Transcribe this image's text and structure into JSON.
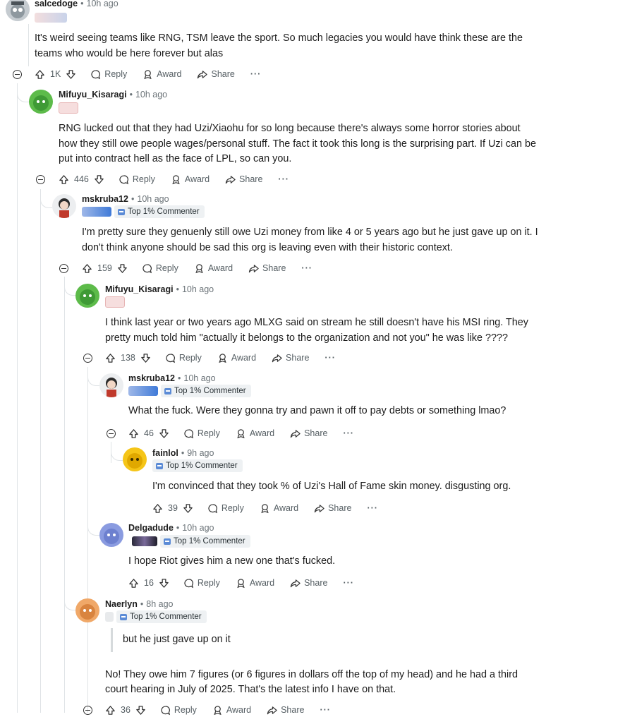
{
  "labels": {
    "reply": "Reply",
    "award": "Award",
    "share": "Share",
    "more": "···"
  },
  "comments": [
    {
      "user": "salcedoge",
      "time": "10h ago",
      "votes": "1K",
      "text": "It's weird seeing teams like RNG, TSM leave the sport. So much legacies you would have think these are the teams who would be here forever but alas"
    },
    {
      "user": "Mifuyu_Kisaragi",
      "time": "10h ago",
      "votes": "446",
      "text": "RNG lucked out that they had Uzi/Xiaohu for so long because there's always some horror stories about how they still owe people wages/personal stuff. The fact it took this long is the surprising part. If Uzi can be put into contract hell as the face of LPL, so can you."
    },
    {
      "user": "mskruba12",
      "time": "10h ago",
      "votes": "159",
      "badge": "Top 1% Commenter",
      "text": "I'm pretty sure they genuenly still owe Uzi money from like 4 or 5 years ago but he just gave up on it. I don't think anyone should be sad this org is leaving even with their historic context."
    },
    {
      "user": "Mifuyu_Kisaragi",
      "time": "10h ago",
      "votes": "138",
      "text": "I think last year or two years ago MLXG said on stream he still doesn't have his MSI ring. They pretty much told him \"actually it belongs to the organization and not you\" he was like ????"
    },
    {
      "user": "mskruba12",
      "time": "10h ago",
      "votes": "46",
      "badge": "Top 1% Commenter",
      "text": "What the fuck. Were they gonna try and pawn it off to pay debts or something lmao?"
    },
    {
      "user": "fainlol",
      "time": "9h ago",
      "votes": "39",
      "badge": "Top 1% Commenter",
      "text": "I'm convinced that they took % of Uzi's Hall of Fame skin money. disgusting org."
    },
    {
      "user": "Delgadude",
      "time": "10h ago",
      "votes": "16",
      "badge": "Top 1% Commenter",
      "text": "I hope Riot gives him a new one that's fucked."
    },
    {
      "user": "Naerlyn",
      "time": "8h ago",
      "votes": "36",
      "badge": "Top 1% Commenter",
      "quote": "but he just gave up on it",
      "text": "No! They owe him 7 figures (or 6 figures in dollars off the top of my head) and he had a third court hearing in July of 2025. That's the latest info I have on that."
    }
  ]
}
